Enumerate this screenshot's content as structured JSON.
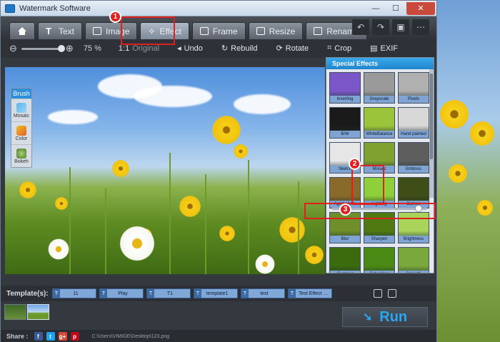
{
  "window": {
    "title": "Watermark Software",
    "controls": {
      "minimize": "—",
      "maximize": "☐",
      "close": "✕"
    }
  },
  "tabs": [
    {
      "label": "",
      "icon": "home-icon"
    },
    {
      "label": "Text",
      "icon": "text-icon"
    },
    {
      "label": "Image",
      "icon": "image-icon"
    },
    {
      "label": "Effect",
      "icon": "magic-wand-icon"
    },
    {
      "label": "Frame",
      "icon": "frame-icon"
    },
    {
      "label": "Resize",
      "icon": "resize-icon"
    },
    {
      "label": "Rename",
      "icon": "rename-icon"
    }
  ],
  "active_tab": "Effect",
  "tab_tools": [
    "↶",
    "↷",
    "▣",
    "⋯"
  ],
  "toolbar": {
    "zoom_minus": "⊖",
    "zoom_plus": "⊕",
    "zoom_level": "75 %",
    "original_glyph": "1:1",
    "original_label": "Original",
    "undo": "Undo",
    "rebuild": "Rebuild",
    "rotate": "Rotate",
    "crop": "Crop",
    "exif": "EXIF"
  },
  "brush": {
    "title": "Brush",
    "items": [
      "Mosaic",
      "Color",
      "Bokeh"
    ]
  },
  "special_effects": {
    "title": "Special Effects",
    "items": [
      {
        "label": "Inverting",
        "color": "#7b56c9"
      },
      {
        "label": "Grayscale",
        "color": "#9a9a9a"
      },
      {
        "label": "Pixels",
        "color": "#b0b0b0"
      },
      {
        "label": "B/W",
        "color": "#1a1a1a"
      },
      {
        "label": "WhiteBalance",
        "color": "#9cc43a"
      },
      {
        "label": "Hand painted",
        "color": "#d8d8d8"
      },
      {
        "label": "Sketch",
        "color": "#e6e6e6"
      },
      {
        "label": "Mosaic",
        "color": "#7fa12f"
      },
      {
        "label": "Emboss",
        "color": "#5e5e5e"
      },
      {
        "label": "Aged photo",
        "color": "#8a6a2a"
      },
      {
        "label": "Lighting",
        "color": "#8fcf3a"
      },
      {
        "label": "Darken",
        "color": "#3f4d16"
      },
      {
        "label": "Blur",
        "color": "#6f8f2a"
      },
      {
        "label": "Sharpen",
        "color": "#4f7a12"
      },
      {
        "label": "Brightness",
        "color": "#a8d45a"
      },
      {
        "label": "Contrast",
        "color": "#3c6a0e"
      },
      {
        "label": "Saturation",
        "color": "#4c8a16"
      },
      {
        "label": "Smooth",
        "color": "#7ba83c"
      }
    ],
    "slider_value": 0.88
  },
  "annotations": [
    "1",
    "2",
    "3"
  ],
  "templates": {
    "label": "Template(s):",
    "items": [
      "11",
      "Play",
      "T1",
      "template1",
      "test",
      "Text Effect ..."
    ]
  },
  "run": {
    "label": "Run",
    "icon": "run-icon"
  },
  "share": {
    "label": "Share :",
    "networks": [
      "f",
      "t",
      "g+",
      "p"
    ],
    "path": "C:\\Users\\VIMIGE\\Desktop\\123.png"
  }
}
